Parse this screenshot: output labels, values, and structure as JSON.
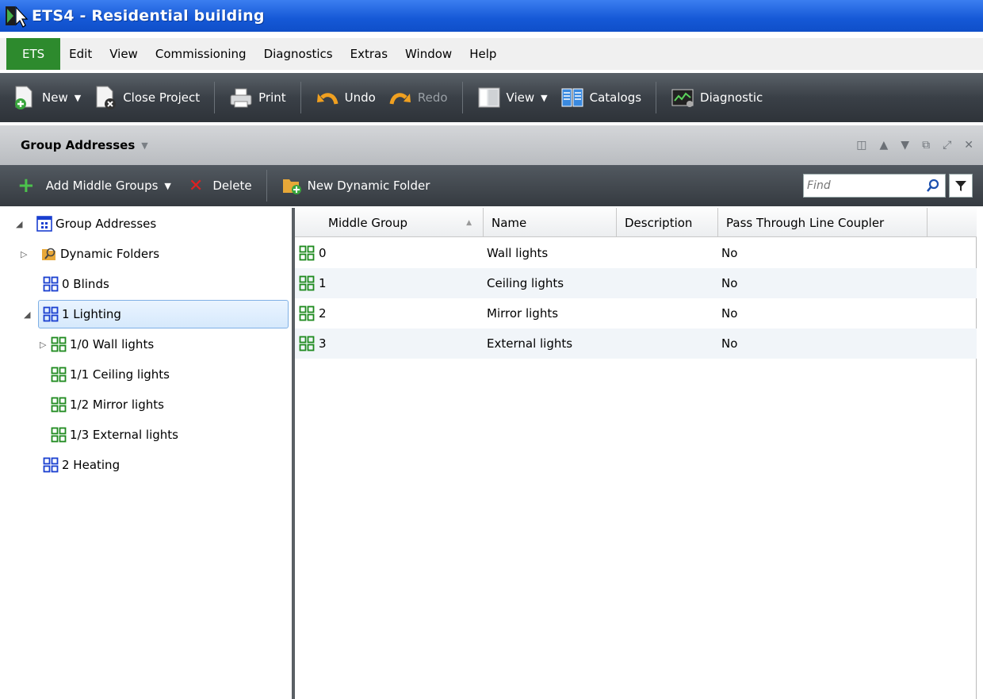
{
  "window": {
    "title": "ETS4 - Residential building"
  },
  "menu": [
    "ETS",
    "Edit",
    "View",
    "Commissioning",
    "Diagnostics",
    "Extras",
    "Window",
    "Help"
  ],
  "toolbar": {
    "new_label": "New",
    "close_project_label": "Close Project",
    "print_label": "Print",
    "undo_label": "Undo",
    "redo_label": "Redo",
    "view_label": "View",
    "catalogs_label": "Catalogs",
    "diagnostics_label": "Diagnostic"
  },
  "panel": {
    "title": "Group Addresses"
  },
  "subtoolbar": {
    "add_label": "Add Middle Groups",
    "delete_label": "Delete",
    "new_dynamic_folder_label": "New Dynamic Folder",
    "find_placeholder": "Find"
  },
  "tree": {
    "root": "Group Addresses",
    "items": [
      {
        "label": "Dynamic Folders"
      },
      {
        "label": "0 Blinds"
      },
      {
        "label": "1 Lighting"
      },
      {
        "label": "1/0 Wall lights"
      },
      {
        "label": "1/1 Ceiling lights"
      },
      {
        "label": "1/2 Mirror lights"
      },
      {
        "label": "1/3 External lights"
      },
      {
        "label": "2 Heating"
      }
    ]
  },
  "grid": {
    "columns": [
      "Middle Group",
      "Name",
      "Description",
      "Pass Through Line Coupler"
    ],
    "rows": [
      {
        "group": "0",
        "name": "Wall lights",
        "description": "",
        "pass": "No"
      },
      {
        "group": "1",
        "name": "Ceiling lights",
        "description": "",
        "pass": "No"
      },
      {
        "group": "2",
        "name": "Mirror lights",
        "description": "",
        "pass": "No"
      },
      {
        "group": "3",
        "name": "External lights",
        "description": "",
        "pass": "No"
      }
    ]
  },
  "colors": {
    "title_bar": "#1558d6",
    "menu_ets": "#2d8a2d",
    "toolbar": "#3a4047",
    "blue_group": "#1a3fd0",
    "green_group": "#1e8a1e"
  }
}
